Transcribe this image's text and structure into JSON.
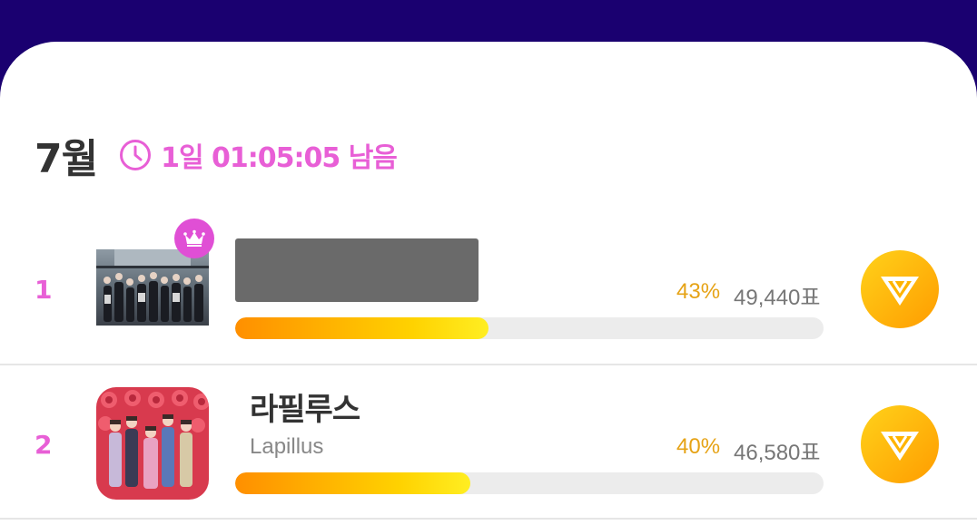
{
  "header": {
    "month": "7월",
    "countdown": "1일 01:05:05 남음",
    "accent_color": "#e85fd6",
    "clock_icon": "clock-icon"
  },
  "ranking": [
    {
      "rank": "1",
      "name": "",
      "subtitle": "",
      "percent": "43%",
      "votes": "49,440표",
      "progress": 0.43,
      "crown": true,
      "redacted": true
    },
    {
      "rank": "2",
      "name": "라필루스",
      "subtitle": "Lapillus",
      "percent": "40%",
      "votes": "46,580표",
      "progress": 0.4,
      "crown": false,
      "redacted": false
    }
  ],
  "colors": {
    "top_bar": "#1a0070",
    "rank": "#e85fd6",
    "percent": "#e6a316",
    "crown_badge": "#e04fd5"
  },
  "icons": {
    "vote": "vote-diamond-icon",
    "crown": "crown-icon"
  }
}
